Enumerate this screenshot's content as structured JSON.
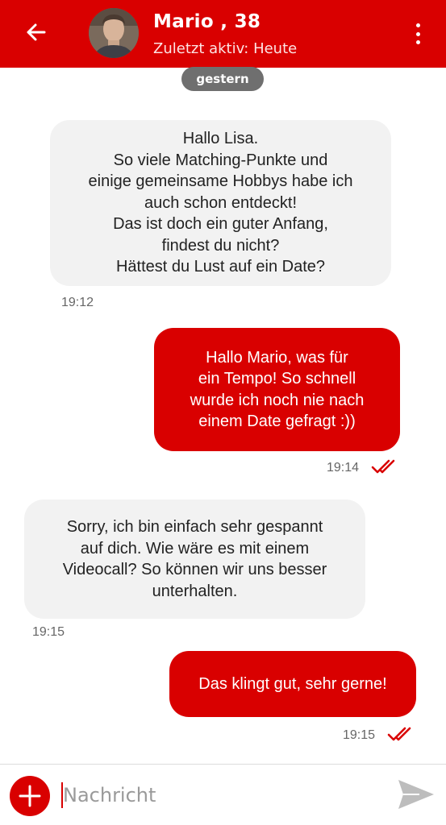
{
  "header": {
    "contact_name": "Mario , 38",
    "status": "Zuletzt aktiv: Heute"
  },
  "day_separator": "gestern",
  "messages": [
    {
      "direction": "incoming",
      "text": "Hallo Lisa.\nSo viele Matching-Punkte und\neinige gemeinsame Hobbys habe ich\nauch schon entdeckt!\nDas ist doch ein guter Anfang,\nfindest du nicht?\nHättest du Lust auf ein Date?",
      "time": "19:12"
    },
    {
      "direction": "outgoing",
      "text": "Hallo Mario, was für\nein Tempo! So schnell\nwurde ich noch nie nach\neinem Date gefragt :))",
      "time": "19:14",
      "read": true
    },
    {
      "direction": "incoming",
      "text": "Sorry, ich bin einfach sehr gespannt\nauf dich. Wie wäre es mit einem\nVideocall? So können wir uns besser\nunterhalten.",
      "time": "19:15"
    },
    {
      "direction": "outgoing",
      "text": "Das klingt gut, sehr gerne!",
      "time": "19:15",
      "read": true
    }
  ],
  "composer": {
    "placeholder": "Nachricht"
  },
  "colors": {
    "accent": "#d90000",
    "incoming_bubble": "#f2f2f2",
    "day_pill": "#6f6f6f"
  },
  "icons": {
    "back": "arrow-left-icon",
    "menu": "kebab-menu-icon",
    "add": "plus-icon",
    "send": "send-icon",
    "read_receipt": "double-check-icon"
  }
}
